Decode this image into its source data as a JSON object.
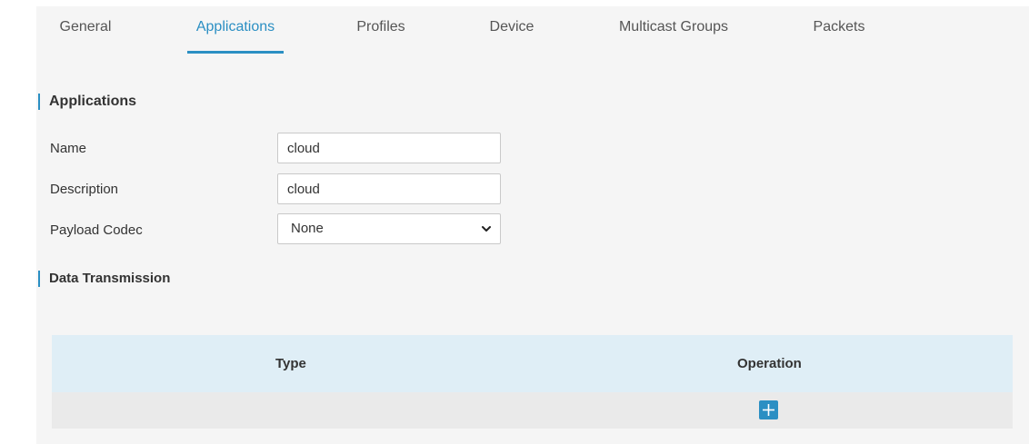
{
  "tabs": [
    {
      "label": "General",
      "active": false
    },
    {
      "label": "Applications",
      "active": true
    },
    {
      "label": "Profiles",
      "active": false
    },
    {
      "label": "Device",
      "active": false
    },
    {
      "label": "Multicast Groups",
      "active": false
    },
    {
      "label": "Packets",
      "active": false
    }
  ],
  "applications_section": {
    "title": "Applications",
    "name_label": "Name",
    "name_value": "cloud",
    "description_label": "Description",
    "description_value": "cloud",
    "codec_label": "Payload Codec",
    "codec_value": "None"
  },
  "data_transmission": {
    "title": "Data Transmission",
    "columns": [
      "Type",
      "Operation"
    ],
    "add_icon": "plus-icon"
  },
  "colors": {
    "accent": "#2b8fc3",
    "page_bg": "#f5f5f5",
    "table_head_bg": "#dfeef6",
    "table_row_bg": "#eaeaea"
  }
}
